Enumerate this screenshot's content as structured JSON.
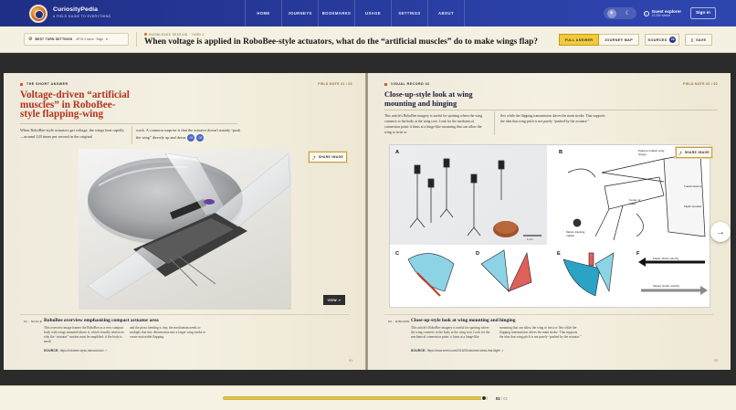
{
  "app": {
    "name": "CuriosityPedia",
    "tagline": "A FIELD GUIDE TO EVERYTHING"
  },
  "nav": {
    "items": [
      "HOME",
      "JOURNEYS",
      "BOOKMARKS",
      "USAGE",
      "SETTINGS",
      "ABOUT"
    ]
  },
  "user": {
    "name": "Guest explorer",
    "status": "19,250 saved",
    "signin": "Sign in"
  },
  "toolbar": {
    "settings_label": "BEST TURN SETTINGS",
    "settings_value": "API 8.4 mono · Sage",
    "meta": "KNOWLEDGE SESSION · TURN 4",
    "question": "When voltage is applied in RoboBee-style actuators, what do the “artificial muscles” do to make wings flap?",
    "buttons": {
      "full_answer": "FULL ANSWER",
      "journey_map": "JOURNEY MAP",
      "sources": "SOURCES",
      "sources_count": "31",
      "save": "SAVE"
    }
  },
  "left_page": {
    "kicker": "THE SHORT ANSWER",
    "field_note": "FIELD NOTE 01 / 02",
    "headline": "Voltage-driven “artificial muscles” in RoboBee-style flapping-wing",
    "para1": "When RoboBee-style actuators get voltage, the wings beat rapidly—around 120 times per second in the original",
    "para2": "work. A common surprise is that the actuator doesn't mainly “push the wing” directly up and down.",
    "citations": [
      "01",
      "02"
    ],
    "share_label": "SHARE IMAGE",
    "view_label": "VIEW ↗",
    "caption_tag": "01 · SCALE",
    "caption_title": "RoboBee overview emphasizing compact actuator area",
    "caption_col1": "This overview image frames the RoboBee as a very compact body with wings mounted above it, which visually reinforces why the “actuator” motion must be amplified: if the body is small",
    "caption_col2": "and the piezo bending is tiny, the mechanism needs to multiply that tiny deformation into a larger wing stroke to create noticeable flapping.",
    "source_label": "SOURCE:",
    "source_url": "https://robobee.wyss.harvard.edu/",
    "page_number": "01"
  },
  "right_page": {
    "kicker": "VISUAL RECORD 02",
    "field_note": "FIELD NOTE 02 / 02",
    "headline": "Close-up-style look at wing mounting and hinging",
    "para1": "This article's RoboBee imagery is useful for spotting where the wing connects to the body at the wing root. Look for the mechanical connection point: it hints at a hinge-like mounting that can allow the wing to twist or",
    "para2": "flex while the flapping transmission drives the main stroke. That supports the idea that wing pitch is not purely “pushed by the actuator.”",
    "share_label": "SHARE IMAGE",
    "figure": {
      "panels": [
        "A",
        "B",
        "C",
        "D",
        "E",
        "F"
      ],
      "b_labels": [
        "Passive rotation wing hinges",
        "Transmissions",
        "Center of mass",
        "Flight muscles",
        "Motion tracking marker"
      ],
      "a_scale": "1 cm",
      "f_labels": [
        "Faster stroke velocity",
        "Slower stroke velocity"
      ]
    },
    "caption_tag": "02 · HINGING",
    "caption_title": "Close-up-style look at wing mounting and hinging",
    "caption_col1": "This article's RoboBee imagery is useful for spotting where the wing connects to the body at the wing root. Look for the mechanical connection point: it hints at a hinge-like",
    "caption_col2": "mounting that can allow the wing to twist or flex while the flapping transmission drives the main stroke. That supports the idea that wing pitch is not purely “pushed by the actuator.”",
    "source_label": "SOURCE:",
    "source_url": "https://www.wired.com/2013/05/robobee-takes-first-flight/",
    "page_number": "02"
  },
  "progress": {
    "current": "02",
    "total": "02",
    "fraction": 0.99
  },
  "colors": {
    "nav_bg": "#2a3ea3",
    "accent": "#f3c93c",
    "headline_red": "#b3331b"
  }
}
